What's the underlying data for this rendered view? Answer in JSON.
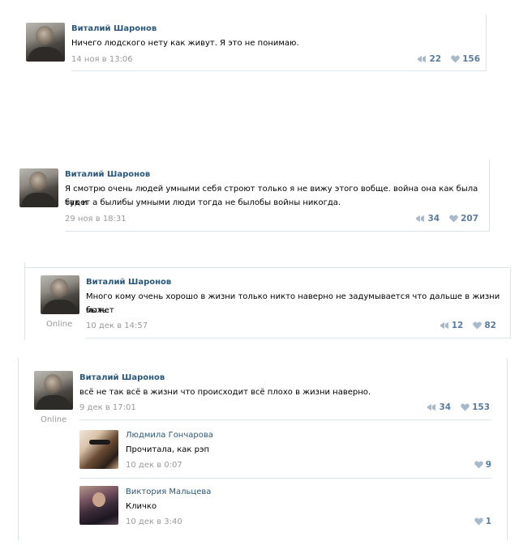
{
  "posts": [
    {
      "author": "Виталий Шаронов",
      "text": "Ничего людского нету как живут. Я это не понимаю.",
      "date": "14 ноя в 13:06",
      "shares": "22",
      "likes": "156"
    },
    {
      "author": "Виталий Шаронов",
      "text_line1": "Я смотрю очень людей умными себя строют только я не вижу этого вобще. война она как была так и",
      "text_line2": "будет а былибы умными люди тогда не былобы войны никогда.",
      "date": "29 ноя в 18:31",
      "shares": "34",
      "likes": "207"
    },
    {
      "author": "Виталий Шаронов",
      "text_line1": "Много кому очень хорошо в жизни только никто наверно не задумывается что дальше в жизни может",
      "text_line2": "быть.",
      "status": "Online",
      "date": "10 дек в 14:57",
      "shares": "12",
      "likes": "82"
    },
    {
      "author": "Виталий Шаронов",
      "text": "всё не так всё в жизни что происходит всё плохо в жизни наверно.",
      "status": "Online",
      "date": "9 дек в 17:01",
      "shares": "34",
      "likes": "153",
      "comments": [
        {
          "author": "Людмила Гончарова",
          "text": "Прочитала, как рэп",
          "date": "10 дек в 0:07",
          "likes": "9"
        },
        {
          "author": "Виктория Мальцева",
          "text": "Кличко",
          "date": "10 дек в 3:40",
          "likes": "1"
        }
      ]
    }
  ],
  "icons": {
    "share": "megaphone-icon",
    "like": "heart-icon"
  },
  "colors": {
    "name": "#2b587a",
    "stats": "#5c7c9e",
    "meta": "#999999",
    "divider": "#dde3ea"
  }
}
